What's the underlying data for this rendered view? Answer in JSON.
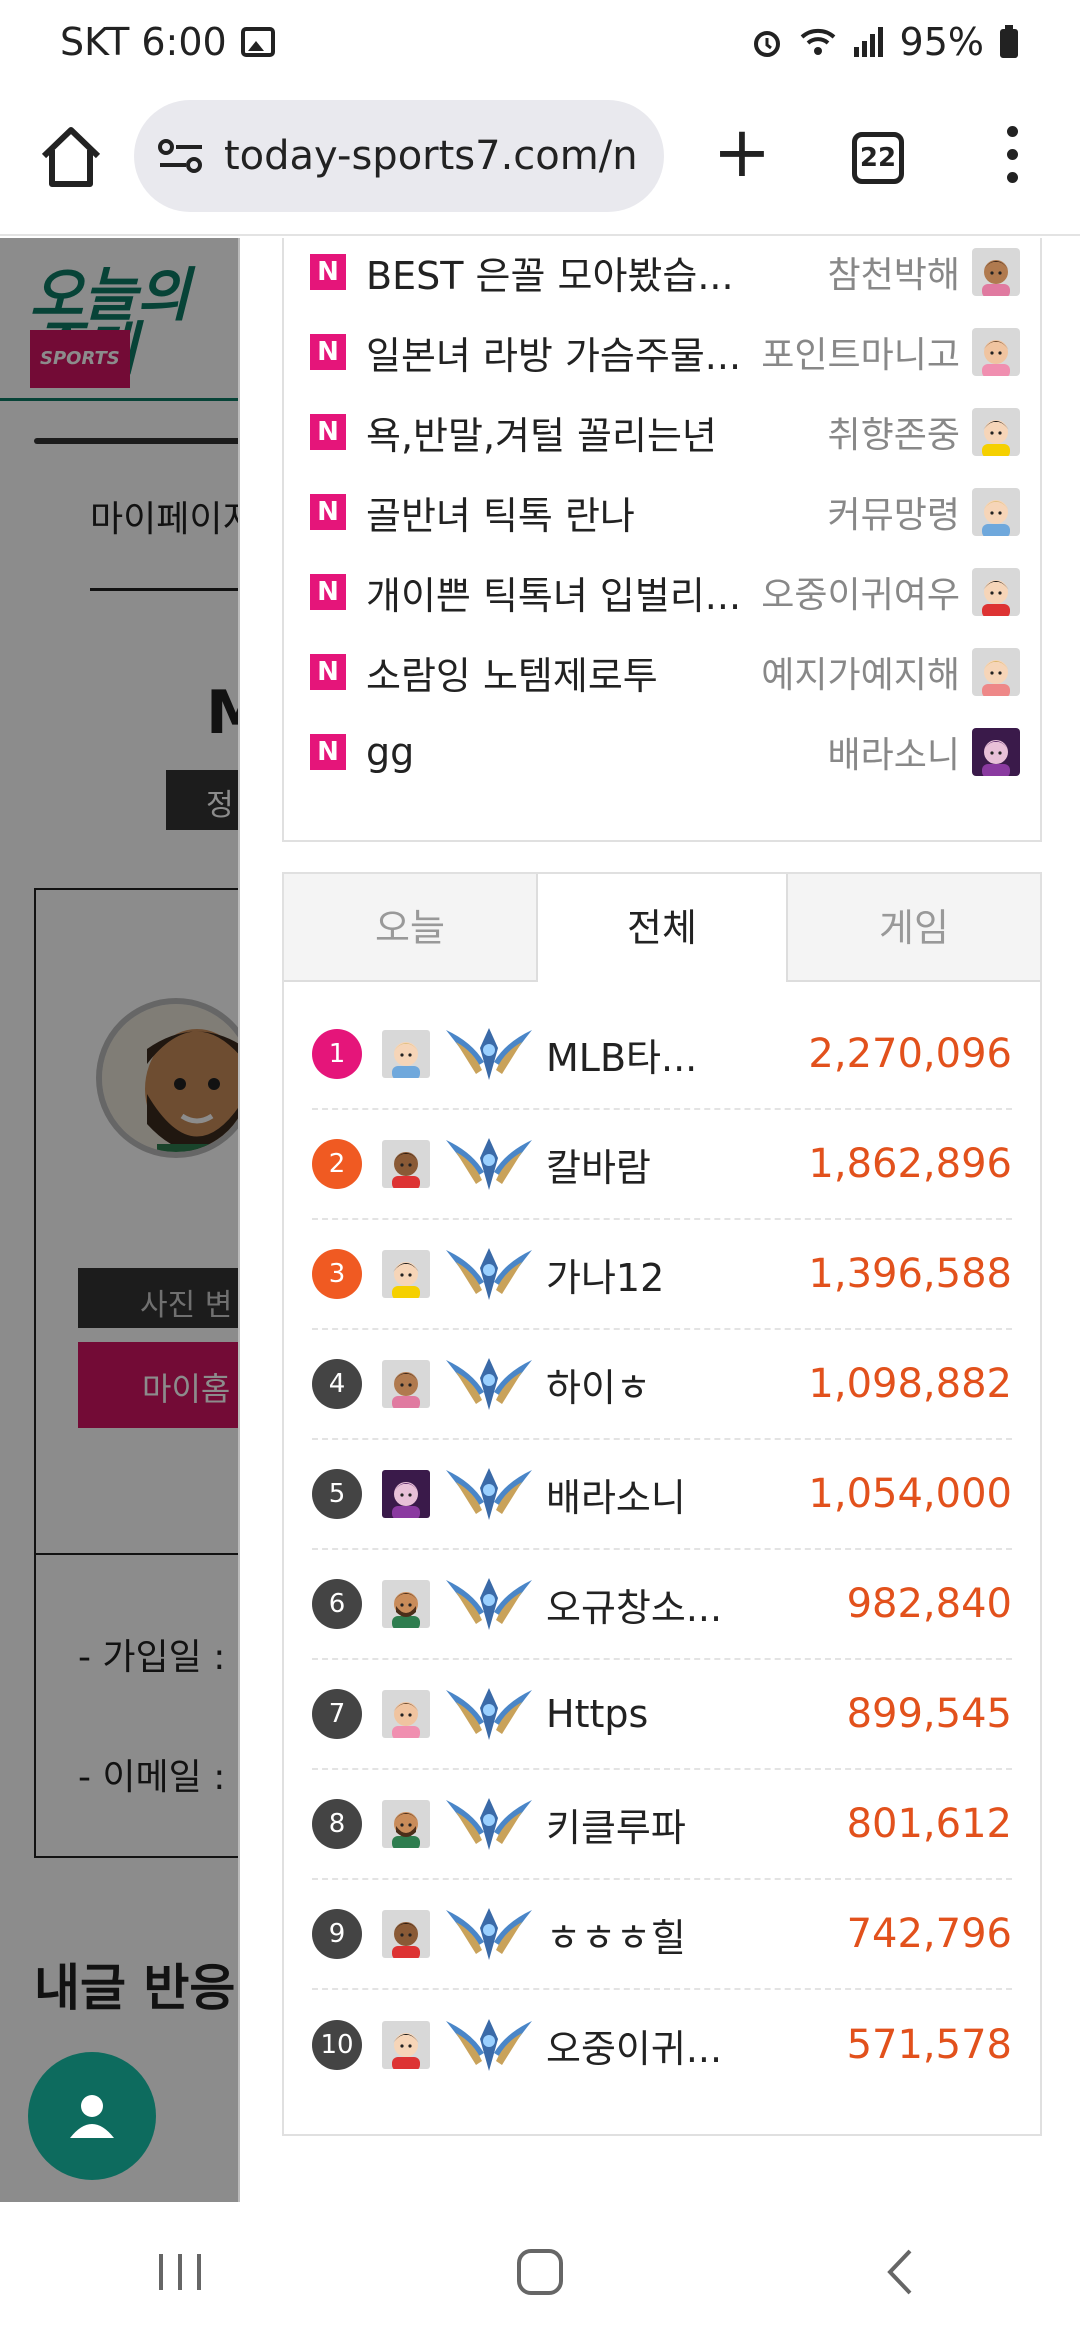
{
  "status_bar": {
    "carrier_time": "SKT 6:00",
    "battery": "95%"
  },
  "browser": {
    "url": "today-sports7.com/n",
    "tab_count": "22"
  },
  "background_page": {
    "logo_text": "오늘의 중계",
    "logo_tag": "SPORTS",
    "nav_label": "마이페이지",
    "heading_fragment": "M",
    "badge": "정",
    "photo_button": "사진 변",
    "myhome_button": "마이홈",
    "join_date_label": "- 가입일 :",
    "email_label": "- 이메일 :",
    "section_title": "내글 반응"
  },
  "recent_posts": [
    {
      "title": "BEST 은꼴 모아봤습...",
      "author": "참천박해",
      "avatar": "girl-brown"
    },
    {
      "title": "일본녀 라방 가슴주물...",
      "author": "포인트마니고",
      "avatar": "girl-light"
    },
    {
      "title": "욕,반말,겨털 꼴리는년",
      "author": "취향존중",
      "avatar": "girl-yellow"
    },
    {
      "title": "골반녀 틱톡 란나",
      "author": "커뮤망령",
      "avatar": "boy-blond"
    },
    {
      "title": "개이쁜 틱톡녀 입벌리...",
      "author": "오중이귀여우",
      "avatar": "boy-red"
    },
    {
      "title": "소람잉 노템제로투",
      "author": "예지가예지해",
      "avatar": "girl-blond"
    },
    {
      "title": "gg",
      "author": "배라소니",
      "avatar": "photo-purple"
    }
  ],
  "rank_tabs": [
    {
      "label": "오늘"
    },
    {
      "label": "전체"
    },
    {
      "label": "게임"
    }
  ],
  "active_tab": "전체",
  "rankings": [
    {
      "rank": "1",
      "name": "MLB타...",
      "score": "2,270,096",
      "color": "#e5157a",
      "avatar": "boy-blond"
    },
    {
      "rank": "2",
      "name": "칼바람",
      "score": "1,862,896",
      "color": "#f05a22",
      "avatar": "boy-dark"
    },
    {
      "rank": "3",
      "name": "가나12",
      "score": "1,396,588",
      "color": "#f05a22",
      "avatar": "girl-yellow"
    },
    {
      "rank": "4",
      "name": "하이ㅎ",
      "score": "1,098,882",
      "color": "#444444",
      "avatar": "girl-brown"
    },
    {
      "rank": "5",
      "name": "배라소니",
      "score": "1,054,000",
      "color": "#444444",
      "avatar": "photo-purple"
    },
    {
      "rank": "6",
      "name": "오규창소...",
      "score": "982,840",
      "color": "#444444",
      "avatar": "man-beard"
    },
    {
      "rank": "7",
      "name": "Https",
      "score": "899,545",
      "color": "#444444",
      "avatar": "girl-light"
    },
    {
      "rank": "8",
      "name": "키클루파",
      "score": "801,612",
      "color": "#444444",
      "avatar": "man-beard"
    },
    {
      "rank": "9",
      "name": "ㅎㅎㅎ힐",
      "score": "742,796",
      "color": "#444444",
      "avatar": "boy-dark"
    },
    {
      "rank": "10",
      "name": "오중이귀...",
      "score": "571,578",
      "color": "#444444",
      "avatar": "boy-red"
    }
  ],
  "colors": {
    "brand_green": "#0d7a64",
    "brand_pink": "#e5157a",
    "score_orange": "#e2511c"
  }
}
